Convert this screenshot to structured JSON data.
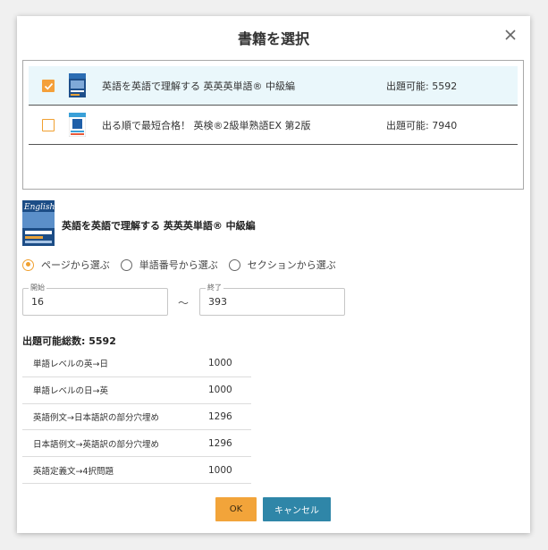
{
  "dialog": {
    "title": "書籍を選択"
  },
  "books": [
    {
      "name": "英語を英語で理解する 英英英単語® 中級編",
      "count_label": "出題可能: 5592",
      "checked": true
    },
    {
      "name": "出る順で最短合格！ 英検®2級単熟語EX 第2版",
      "count_label": "出題可能: 7940",
      "checked": false
    }
  ],
  "selected_book": {
    "title": "英語を英語で理解する 英英英単語® 中級編",
    "cover_text": "English"
  },
  "range_mode": {
    "options": [
      "ページから選ぶ",
      "単語番号から選ぶ",
      "セクションから選ぶ"
    ],
    "selected_index": 0
  },
  "range": {
    "start_label": "開始",
    "start_value": "16",
    "separator": "〜",
    "end_label": "終了",
    "end_value": "393"
  },
  "total": {
    "label": "出題可能総数: 5592"
  },
  "question_types": [
    {
      "name": "単語レベルの英→日",
      "count": "1000"
    },
    {
      "name": "単語レベルの日→英",
      "count": "1000"
    },
    {
      "name": "英語例文→日本語訳の部分穴埋め",
      "count": "1296"
    },
    {
      "name": "日本語例文→英語訳の部分穴埋め",
      "count": "1296"
    },
    {
      "name": "英語定義文→4択問題",
      "count": "1000"
    }
  ],
  "buttons": {
    "ok": "OK",
    "cancel": "キャンセル"
  },
  "colors": {
    "accent_orange": "#f2a43a",
    "cancel_blue": "#2f86a8",
    "selected_row": "#eaf7fb"
  },
  "icons": {
    "close": "close-icon",
    "check": "check-icon"
  }
}
